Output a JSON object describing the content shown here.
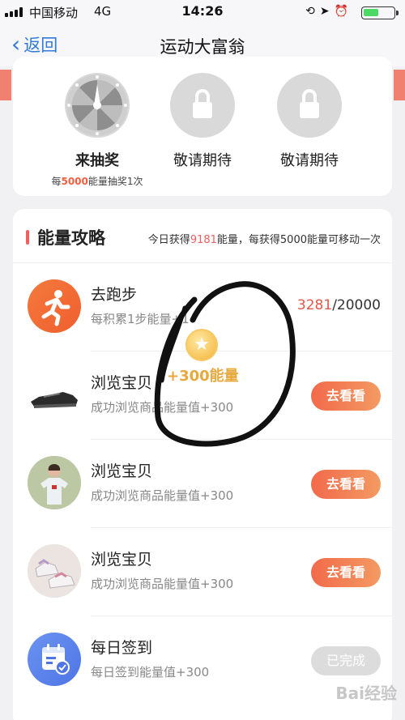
{
  "status_bar": {
    "carrier": "中国移动",
    "network": "4G",
    "time": "14:26"
  },
  "nav": {
    "back_label": "返回",
    "title": "运动大富翁"
  },
  "lottery": {
    "slots": [
      {
        "label": "来抽奖",
        "sub_prefix": "每",
        "sub_highlight": "5000",
        "sub_suffix": "能量抽奖1次"
      },
      {
        "label": "敬请期待"
      },
      {
        "label": "敬请期待"
      }
    ]
  },
  "strategy": {
    "title": "能量攻略",
    "note_prefix": "今日获得",
    "note_highlight": "9181",
    "note_suffix": "能量，每获得5000能量可移动一次",
    "items": [
      {
        "title": "去跑步",
        "subtitle": "每积累1步能量+1",
        "progress_current": "3281",
        "progress_total": "/20000"
      },
      {
        "title": "浏览宝贝",
        "subtitle": "成功浏览商品能量值+300",
        "button": "去看看"
      },
      {
        "title": "浏览宝贝",
        "subtitle": "成功浏览商品能量值+300",
        "button": "去看看"
      },
      {
        "title": "浏览宝贝",
        "subtitle": "成功浏览商品能量值+300",
        "button": "去看看"
      },
      {
        "title": "每日签到",
        "subtitle": "每日签到能量值+300",
        "button": "已完成"
      }
    ]
  },
  "popup": {
    "reward_text": "+300能量"
  },
  "watermark": "Bai经验",
  "colors": {
    "accent": "#f06060",
    "button": "#f26a4b",
    "link": "#2f7bd8",
    "coin": "#e7a83c"
  }
}
